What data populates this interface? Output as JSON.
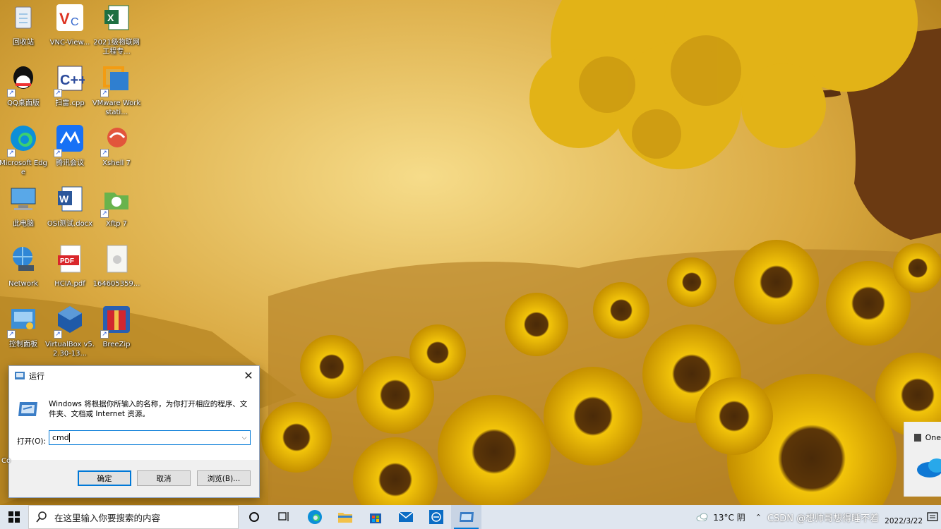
{
  "desktop_icons": [
    {
      "label": "回收站"
    },
    {
      "label": "VNC-View..."
    },
    {
      "label": "2021级物联网工程专..."
    },
    {
      "label": "QQ桌面版"
    },
    {
      "label": "扫雷.cpp"
    },
    {
      "label": "VMware Workstati..."
    },
    {
      "label": "Microsoft Edge"
    },
    {
      "label": "腾讯会议"
    },
    {
      "label": "Xshell 7"
    },
    {
      "label": "此电脑"
    },
    {
      "label": "OSI测试.docx"
    },
    {
      "label": "Xftp 7"
    },
    {
      "label": "Network"
    },
    {
      "label": "HCIA.pdf"
    },
    {
      "label": "164605359..."
    },
    {
      "label": "控制面板"
    },
    {
      "label": "VirtualBox v5.2.30-13..."
    },
    {
      "label": "BreeZip"
    }
  ],
  "run_dialog": {
    "title": "运行",
    "description": "Windows 将根据你所输入的名称，为你打开相应的程序、文件夹、文档或 Internet 资源。",
    "open_label": "打开(O):",
    "input_value": "cmd",
    "ok_label": "确定",
    "cancel_label": "取消",
    "browse_label": "浏览(B)..."
  },
  "notification": {
    "title": "One"
  },
  "taskbar": {
    "search_placeholder": "在这里输入你要搜索的内容",
    "weather": "13°C 阴",
    "watermark": "CSDN @想帅哥想得睡不着",
    "date": "2022/3/22",
    "edge_left_label": "Co"
  },
  "colors": {
    "accent": "#0078d7",
    "taskbar": "#dfe6ef"
  }
}
